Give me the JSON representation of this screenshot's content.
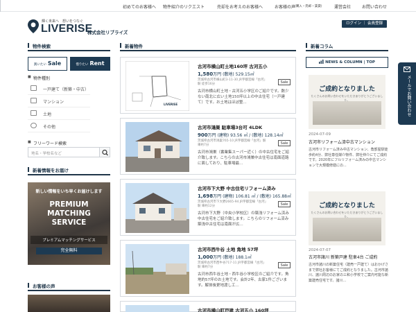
{
  "topnav": [
    "初めてのお客様へ",
    "物件紹介のリクエスト",
    "売却をお考えのお客様へ",
    "お客様の声",
    "(購入・売却・賃貸)",
    "運営会社",
    "お問い合わせ"
  ],
  "header": {
    "tagline": "輝く未来へ　想いをつなぐ",
    "logo": "LIVERISE",
    "company": "株式会社リブライズ",
    "login": "ログイン ｜ 会員登録"
  },
  "left": {
    "search_title": "物件検索",
    "buy_small": "買いたい",
    "buy": "Sale",
    "rent_small": "借りたい",
    "rent": "Rent",
    "type_title": "物件種別",
    "categories": [
      "一戸建て（新築・中古）",
      "マンション",
      "土地",
      "その他"
    ],
    "freeword_title": "フリーワード検索",
    "search_placeholder": "地名・学校名など",
    "notify_title": "新着情報をお届け",
    "banner_top": "新しい情報をいち早くお届けします",
    "banner_main1": "PREMIUM",
    "banner_main2": "MATCHING",
    "banner_main3": "SERVICE",
    "banner_sub": "プレミアムマッチングサービス",
    "banner_free": "完全無料",
    "voice_title": "お客様の声"
  },
  "center": {
    "title": "新着物件",
    "listings": [
      {
        "title": "古河市横山町土地160坪 古河五小",
        "price": "1,580",
        "area": "(敷地) 529.15",
        "addr": "茨城県古河市横山町3-11-30 JR宇都宮線「古河」駅 徒歩16分",
        "sale": "Sale",
        "desc": "古河市横山町土地・古河五小学区のご紹介です。数少ない南北に広い土地150坪以上の中古住宅（一戸建て）です。お土地はほぼ整..."
      },
      {
        "title": "古河市鴻巣 駐車場3台可 4LDK",
        "price": "900",
        "area": "(建物) 93.56 ㎡ / (敷地) 128.14",
        "addr": "茨城県古河市鴻巣765-10 JR宇都宮線「古河」駅 車約7分",
        "sale": "Sale",
        "desc": "古河市鴻巣（書業集スーパー近く）の中古住宅をご紹介致します。こちらの古河市鴻巣中古住宅は南面道路に面しており、駐車場最..."
      },
      {
        "title": "古河市下大野 中古住宅リフォーム済み",
        "price": "1,698",
        "area": "(建物) 106.81 ㎡ / (敷地) 165.88",
        "addr": "茨城県古河市下大野2665-94 JR宇都宮線「古河」駅 車約12分",
        "sale": "Sale",
        "desc": "古河市下大野（中央小学校区）の築浅リフォーム済み中古住宅をご紹介致します。こちらのリフォーム済み築浅中古住宅は南面が広..."
      },
      {
        "title": "古河市西牛谷 土地 角地 57坪",
        "price": "1,000",
        "area": "(敷地) 188.1",
        "addr": "茨城県古河市西牛谷717-11 JR宇都宮線「古河」駅 車約7分",
        "sale": "Sale",
        "desc": "古河市西牛谷土地・西牛谷小学校区のご紹介です。角地約57坪のお土地です。会計2年、古家1件ございます。解体後更地渡し工..."
      },
      {
        "title": "古河市横山町戸建 古河五小 160坪",
        "price": "",
        "area": "",
        "addr": "",
        "sale": "",
        "desc": ""
      }
    ],
    "unit_price": "万円",
    "unit_area": "㎡"
  },
  "right": {
    "title": "新着コラム",
    "news_btn": "NEWS & COLUMN | TOP",
    "columns": [
      {
        "img_head": "ご成約となりました",
        "img_sub": "たくさんのお問い合わせをいただきありがとうございました。",
        "date": "2024-07-09",
        "title": "古河市リフォーム済中古マンション",
        "desc": "古河市リフォーム済み中古マンション、角部屋駅徒歩約4分、弊社専任媒介物件、弊社仲介にてご成約です。2020年にフルリフォーム済みの中古マンションで大規模修繕にの..."
      },
      {
        "img_head": "ご成約となりました",
        "img_sub": "たくさんのお問い合わせをいただきありがとうございました。",
        "date": "2024-07-07",
        "title": "古河市諸川 新築戸建 駐車4台 ご成約",
        "desc": "古河市諸川の新築住宅（建売一戸建て）はおかげさまで弊社お客様にてご成約となりました。古河市諸川、諸川周辺のお家の三和小学校でご案内可能な新築建売住宅です。諸川..."
      }
    ]
  },
  "float_tab": "メールでお問い合わせ",
  "colors": {
    "navy": "#1d3a52",
    "bg": "#eef0f3"
  }
}
